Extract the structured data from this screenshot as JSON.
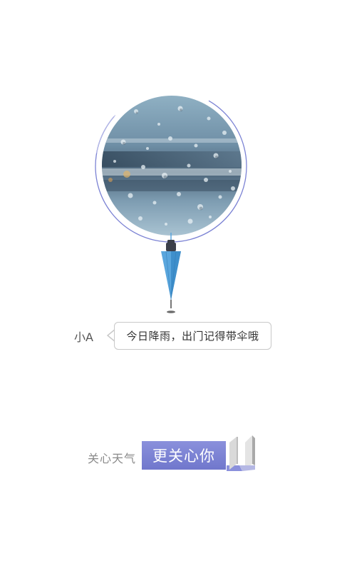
{
  "message": {
    "speaker": "小A",
    "text": "今日降雨，出门记得带伞哦"
  },
  "slogan": {
    "left_text": "关心天气",
    "highlight_text": "更关心你"
  },
  "illustration": {
    "photo": "rainy-window-photo",
    "accessory": "umbrella-icon"
  },
  "colors": {
    "accent": "#7077cc",
    "orbit_ring": "#7b82d4",
    "umbrella": "#5aa6dd",
    "bubble_border": "#c8c8c8"
  }
}
